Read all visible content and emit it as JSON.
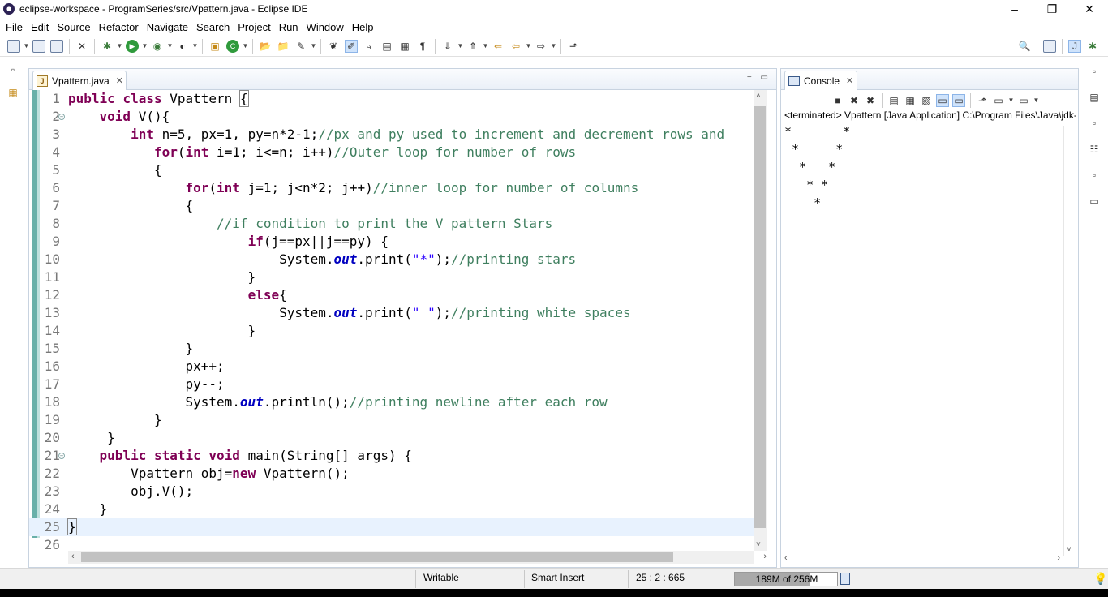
{
  "window": {
    "title": "eclipse-workspace - ProgramSeries/src/Vpattern.java - Eclipse IDE"
  },
  "menu": [
    "File",
    "Edit",
    "Source",
    "Refactor",
    "Navigate",
    "Search",
    "Project",
    "Run",
    "Window",
    "Help"
  ],
  "editor": {
    "tab_label": "Vpattern.java",
    "line_numbers": [
      "1",
      "2",
      "3",
      "4",
      "5",
      "6",
      "7",
      "8",
      "9",
      "10",
      "11",
      "12",
      "13",
      "14",
      "15",
      "16",
      "17",
      "18",
      "19",
      "20",
      "21",
      "22",
      "23",
      "24",
      "25",
      "26"
    ]
  },
  "console": {
    "tab_label": "Console",
    "terminated": "<terminated> Vpattern [Java Application] C:\\Program Files\\Java\\jdk-",
    "output": "*       *\n *     *\n  *   *\n   * *\n    *"
  },
  "status": {
    "writable": "Writable",
    "insert_mode": "Smart Insert",
    "position": "25 : 2 : 665",
    "heap": "189M of 256M",
    "heap_fraction": 0.74
  },
  "colors": {
    "keyword": "#7f0055",
    "comment": "#3f7f5f",
    "string": "#2a00ff",
    "field": "#0000c0"
  }
}
